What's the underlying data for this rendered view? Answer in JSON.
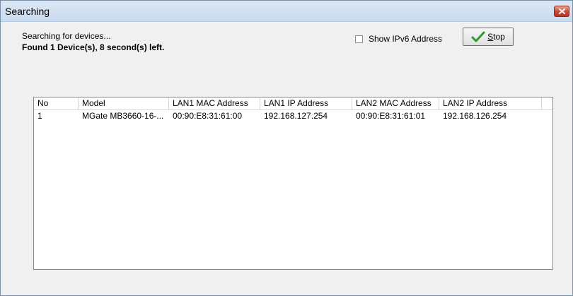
{
  "window": {
    "title": "Searching"
  },
  "search": {
    "status": "Searching for devices...",
    "found": "Found 1 Device(s), 8 second(s) left.",
    "ipv6_label": "Show IPv6 Address",
    "ipv6_checked": false,
    "stop_label": "Stop",
    "stop_mnemonic": "S"
  },
  "table": {
    "columns": [
      "No",
      "Model",
      "LAN1 MAC Address",
      "LAN1 IP Address",
      "LAN2 MAC Address",
      "LAN2 IP Address"
    ],
    "rows": [
      [
        "1",
        "MGate MB3660-16-...",
        "00:90:E8:31:61:00",
        "192.168.127.254",
        "00:90:E8:31:61:01",
        "192.168.126.254"
      ]
    ]
  },
  "icons": {
    "close": "close-icon",
    "stop": "checkmark-icon"
  },
  "colors": {
    "close_button": "#c9473a",
    "checkmark": "#2e9a2e"
  }
}
